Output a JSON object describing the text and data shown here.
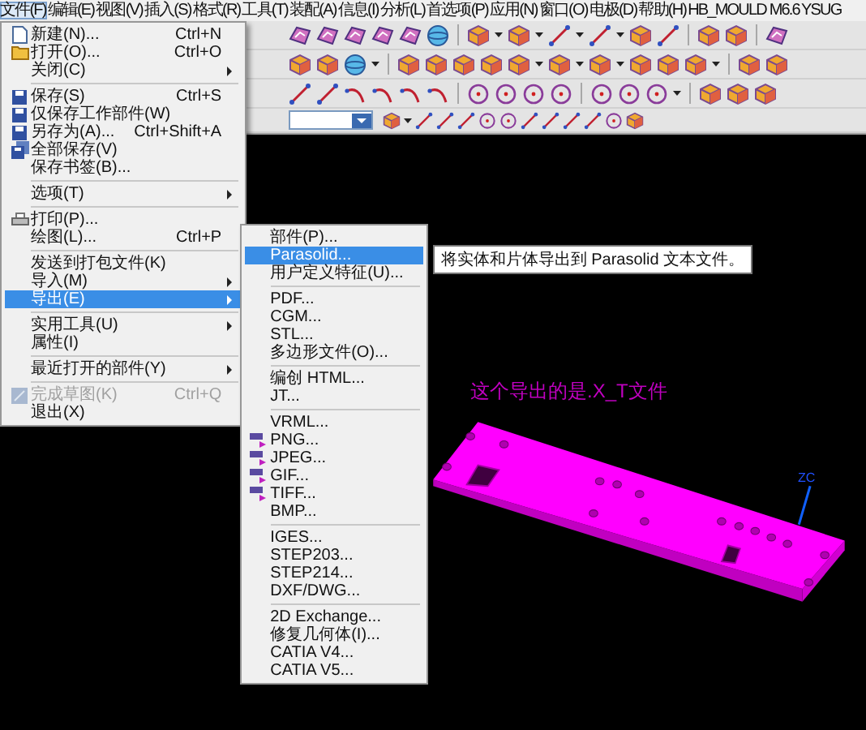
{
  "menu_bar": [
    {
      "label": "文件(F)",
      "selected": true
    },
    {
      "label": "编辑(E)",
      "selected": false
    },
    {
      "label": "视图(V)",
      "selected": false
    },
    {
      "label": "插入(S)",
      "selected": false
    },
    {
      "label": "格式(R)",
      "selected": false
    },
    {
      "label": "工具(T)",
      "selected": false
    },
    {
      "label": "装配(A)",
      "selected": false
    },
    {
      "label": "信息(I)",
      "selected": false
    },
    {
      "label": "分析(L)",
      "selected": false
    },
    {
      "label": "首选项(P)",
      "selected": false
    },
    {
      "label": "应用(N)",
      "selected": false
    },
    {
      "label": "窗口(O)",
      "selected": false
    },
    {
      "label": "电极(D)",
      "selected": false
    },
    {
      "label": "帮助(H)",
      "selected": false
    },
    {
      "label": "HB_MOULD M6.6",
      "selected": false
    },
    {
      "label": "YSUG",
      "selected": false
    }
  ],
  "file_menu": {
    "items": [
      {
        "kind": "item",
        "label": "新建(N)...",
        "shortcut": "Ctrl+N",
        "submenu": false,
        "disabled": false,
        "selected": false
      },
      {
        "kind": "item",
        "label": "打开(O)...",
        "shortcut": "Ctrl+O",
        "submenu": false,
        "disabled": false,
        "selected": false
      },
      {
        "kind": "item",
        "label": "关闭(C)",
        "submenu": true,
        "disabled": false,
        "selected": false
      },
      {
        "kind": "separator"
      },
      {
        "kind": "item",
        "label": "保存(S)",
        "shortcut": "Ctrl+S",
        "submenu": false,
        "disabled": false,
        "selected": false
      },
      {
        "kind": "item",
        "label": "仅保存工作部件(W)",
        "submenu": false,
        "disabled": false,
        "selected": false
      },
      {
        "kind": "item",
        "label": "另存为(A)...",
        "shortcut": "Ctrl+Shift+A",
        "submenu": false,
        "disabled": false,
        "selected": false
      },
      {
        "kind": "item",
        "label": "全部保存(V)",
        "submenu": false,
        "disabled": false,
        "selected": false
      },
      {
        "kind": "item",
        "label": "保存书签(B)...",
        "submenu": false,
        "disabled": false,
        "selected": false
      },
      {
        "kind": "separator"
      },
      {
        "kind": "item",
        "label": "选项(T)",
        "submenu": true,
        "disabled": false,
        "selected": false
      },
      {
        "kind": "separator"
      },
      {
        "kind": "item",
        "label": "打印(P)...",
        "submenu": false,
        "disabled": false,
        "selected": false
      },
      {
        "kind": "item",
        "label": "绘图(L)...",
        "shortcut": "Ctrl+P",
        "submenu": false,
        "disabled": false,
        "selected": false
      },
      {
        "kind": "separator"
      },
      {
        "kind": "item",
        "label": "发送到打包文件(K)",
        "submenu": false,
        "disabled": false,
        "selected": false
      },
      {
        "kind": "item",
        "label": "导入(M)",
        "submenu": true,
        "disabled": false,
        "selected": false
      },
      {
        "kind": "item",
        "label": "导出(E)",
        "submenu": true,
        "disabled": false,
        "selected": true
      },
      {
        "kind": "separator"
      },
      {
        "kind": "item",
        "label": "实用工具(U)",
        "submenu": true,
        "disabled": false,
        "selected": false
      },
      {
        "kind": "item",
        "label": "属性(I)",
        "submenu": false,
        "disabled": false,
        "selected": false
      },
      {
        "kind": "separator"
      },
      {
        "kind": "item",
        "label": "最近打开的部件(Y)",
        "submenu": true,
        "disabled": false,
        "selected": false
      },
      {
        "kind": "separator"
      },
      {
        "kind": "item",
        "label": "完成草图(K)",
        "shortcut": "Ctrl+Q",
        "submenu": false,
        "disabled": true,
        "selected": false
      },
      {
        "kind": "item",
        "label": "退出(X)",
        "submenu": false,
        "disabled": false,
        "selected": false
      }
    ]
  },
  "export_menu": {
    "items": [
      {
        "kind": "item",
        "label": "部件(P)...",
        "selected": false
      },
      {
        "kind": "item",
        "label": "Parasolid...",
        "selected": true
      },
      {
        "kind": "item",
        "label": "用户定义特征(U)...",
        "selected": false
      },
      {
        "kind": "separator"
      },
      {
        "kind": "item",
        "label": "PDF...",
        "selected": false
      },
      {
        "kind": "item",
        "label": "CGM...",
        "selected": false
      },
      {
        "kind": "item",
        "label": "STL...",
        "selected": false
      },
      {
        "kind": "item",
        "label": "多边形文件(O)...",
        "selected": false
      },
      {
        "kind": "separator"
      },
      {
        "kind": "item",
        "label": "编创 HTML...",
        "selected": false
      },
      {
        "kind": "item",
        "label": "JT...",
        "selected": false
      },
      {
        "kind": "separator"
      },
      {
        "kind": "item",
        "label": "VRML...",
        "selected": false
      },
      {
        "kind": "item",
        "label": "PNG...",
        "selected": false
      },
      {
        "kind": "item",
        "label": "JPEG...",
        "selected": false
      },
      {
        "kind": "item",
        "label": "GIF...",
        "selected": false
      },
      {
        "kind": "item",
        "label": "TIFF...",
        "selected": false
      },
      {
        "kind": "item",
        "label": "BMP...",
        "selected": false
      },
      {
        "kind": "separator"
      },
      {
        "kind": "item",
        "label": "IGES...",
        "selected": false
      },
      {
        "kind": "item",
        "label": "STEP203...",
        "selected": false
      },
      {
        "kind": "item",
        "label": "STEP214...",
        "selected": false
      },
      {
        "kind": "item",
        "label": "DXF/DWG...",
        "selected": false
      },
      {
        "kind": "separator"
      },
      {
        "kind": "item",
        "label": "2D Exchange...",
        "selected": false
      },
      {
        "kind": "item",
        "label": "修复几何体(I)...",
        "selected": false
      },
      {
        "kind": "item",
        "label": "CATIA V4...",
        "selected": false
      },
      {
        "kind": "item",
        "label": "CATIA V5...",
        "selected": false
      }
    ]
  },
  "tooltip": {
    "text": "将实体和片体导出到 Parasolid 文本文件。"
  },
  "viewport": {
    "caption": "这个导出的是.X_T文件",
    "axis_label": "ZC"
  }
}
